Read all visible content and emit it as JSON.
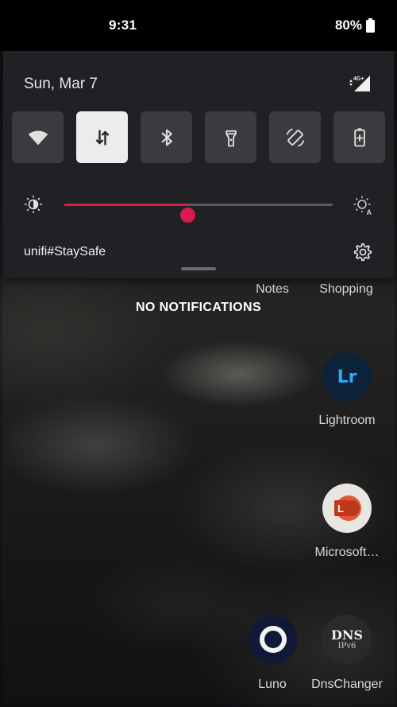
{
  "status_bar": {
    "time": "9:31",
    "battery_percent": "80%"
  },
  "quick_settings": {
    "date": "Sun, Mar 7",
    "signal_label": "4G+",
    "tiles": [
      {
        "name": "wifi",
        "icon": "wifi-icon",
        "active": false
      },
      {
        "name": "mobile-data",
        "icon": "mobile-data-icon",
        "active": true
      },
      {
        "name": "bluetooth",
        "icon": "bluetooth-icon",
        "active": false
      },
      {
        "name": "flashlight",
        "icon": "flashlight-icon",
        "active": false
      },
      {
        "name": "auto-rotate",
        "icon": "auto-rotate-icon",
        "active": false
      },
      {
        "name": "battery-saver",
        "icon": "battery-saver-icon",
        "active": false
      }
    ],
    "brightness": {
      "level": 0.46,
      "accent_color": "#d81b4a",
      "auto_label": "A"
    },
    "network_name": "unifi#StaySafe"
  },
  "notifications": {
    "empty_text": "NO NOTIFICATIONS"
  },
  "home_apps": [
    {
      "label": "Notes"
    },
    {
      "label": "Shopping"
    },
    {
      "label": "Lightroom",
      "icon_text": "Lr"
    },
    {
      "label": "Microsoft…"
    },
    {
      "label": "Luno"
    },
    {
      "label": "DnsChanger",
      "icon_text": "DNS",
      "icon_subtext": "IPv6"
    }
  ]
}
